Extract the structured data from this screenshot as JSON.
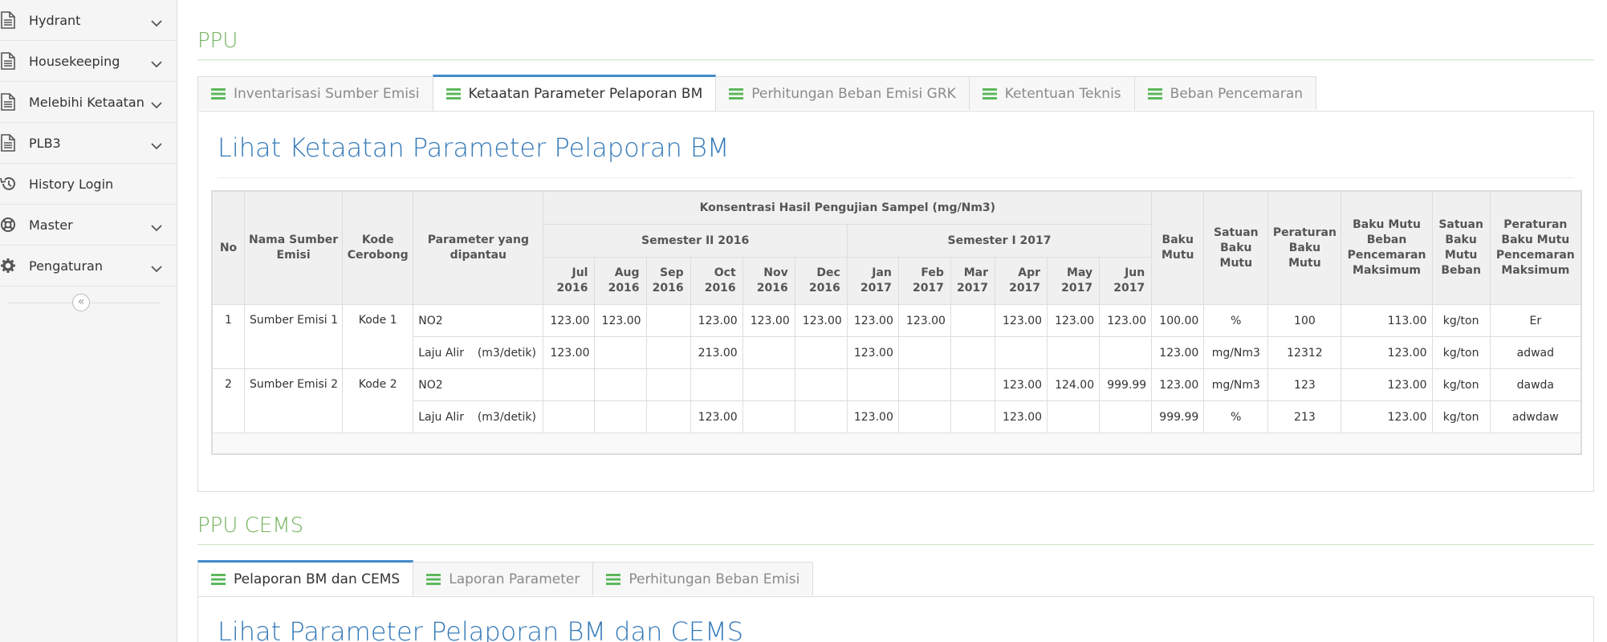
{
  "sidebar": {
    "items": [
      {
        "label": "Hydrant",
        "icon": "file-icon",
        "has_children": true
      },
      {
        "label": "Housekeeping",
        "icon": "file-icon",
        "has_children": true
      },
      {
        "label": "Melebihi Ketaatan",
        "icon": "file-icon",
        "has_children": true
      },
      {
        "label": "PLB3",
        "icon": "file-icon",
        "has_children": true
      },
      {
        "label": "History Login",
        "icon": "history-icon",
        "has_children": false
      },
      {
        "label": "Master",
        "icon": "lifebuoy-icon",
        "has_children": true
      },
      {
        "label": "Pengaturan",
        "icon": "gear-icon",
        "has_children": true
      }
    ],
    "collapse_glyph": "«"
  },
  "ppu": {
    "title": "PPU",
    "tabs": [
      {
        "label": "Inventarisasi Sumber Emisi",
        "active": false
      },
      {
        "label": "Ketaatan Parameter Pelaporan BM",
        "active": true
      },
      {
        "label": "Perhitungan Beban Emisi GRK",
        "active": false
      },
      {
        "label": "Ketentuan Teknis",
        "active": false
      },
      {
        "label": "Beban Pencemaran",
        "active": false
      }
    ],
    "panel_title": "Lihat Ketaatan Parameter Pelaporan BM",
    "table": {
      "h_no": "No",
      "h_nama": "Nama Sumber Emisi",
      "h_kode": "Kode Cerobong",
      "h_param": "Parameter yang dipantau",
      "h_konsentrasi": "Konsentrasi Hasil Pengujian Sampel (mg/Nm3)",
      "h_sem1": "Semester II 2016",
      "h_sem2": "Semester I 2017",
      "months": [
        {
          "m": "Jul",
          "y": "2016"
        },
        {
          "m": "Aug",
          "y": "2016"
        },
        {
          "m": "Sep",
          "y": "2016"
        },
        {
          "m": "Oct",
          "y": "2016"
        },
        {
          "m": "Nov",
          "y": "2016"
        },
        {
          "m": "Dec",
          "y": "2016"
        },
        {
          "m": "Jan",
          "y": "2017"
        },
        {
          "m": "Feb",
          "y": "2017"
        },
        {
          "m": "Mar",
          "y": "2017"
        },
        {
          "m": "Apr",
          "y": "2017"
        },
        {
          "m": "May",
          "y": "2017"
        },
        {
          "m": "Jun",
          "y": "2017"
        }
      ],
      "h_baku": "Baku Mutu",
      "h_satuan": "Satuan Baku Mutu",
      "h_peraturan": "Peraturan Baku Mutu",
      "h_bm_beban": "Baku Mutu Beban Pencemaran Maksimum",
      "h_satuan_beban": "Satuan Baku Mutu Beban",
      "h_peraturan_beban": "Peraturan Baku Mutu Pencemaran Maksimum",
      "rows": [
        {
          "no": "1",
          "nama": "Sumber Emisi 1",
          "kode": "Kode 1",
          "param": "NO2",
          "vals": [
            "123.00",
            "123.00",
            "",
            "123.00",
            "123.00",
            "123.00",
            "123.00",
            "123.00",
            "",
            "123.00",
            "123.00",
            "123.00"
          ],
          "baku": "100.00",
          "satuan": "%",
          "peraturan": "100",
          "bm_beban": "113.00",
          "satuan_beban": "kg/ton",
          "peraturan_beban": "Er",
          "laju_label": "Laju Alir",
          "laju_unit": "(m3/detik)",
          "laju_vals": [
            "123.00",
            "",
            "",
            "213.00",
            "",
            "",
            "123.00",
            "",
            "",
            "",
            "",
            ""
          ],
          "laju_baku": "123.00",
          "laju_satuan": "mg/Nm3",
          "laju_peraturan": "12312",
          "laju_bm_beban": "123.00",
          "laju_satuan_beban": "kg/ton",
          "laju_peraturan_beban": "adwad"
        },
        {
          "no": "2",
          "nama": "Sumber Emisi 2",
          "kode": "Kode 2",
          "param": "NO2",
          "vals": [
            "",
            "",
            "",
            "",
            "",
            "",
            "",
            "",
            "",
            "123.00",
            "124.00",
            "999.99"
          ],
          "baku": "123.00",
          "satuan": "mg/Nm3",
          "peraturan": "123",
          "bm_beban": "123.00",
          "satuan_beban": "kg/ton",
          "peraturan_beban": "dawda",
          "laju_label": "Laju Alir",
          "laju_unit": "(m3/detik)",
          "laju_vals": [
            "",
            "",
            "",
            "123.00",
            "",
            "",
            "123.00",
            "",
            "",
            "123.00",
            "",
            ""
          ],
          "laju_baku": "999.99",
          "laju_satuan": "%",
          "laju_peraturan": "213",
          "laju_bm_beban": "123.00",
          "laju_satuan_beban": "kg/ton",
          "laju_peraturan_beban": "adwdaw"
        }
      ]
    }
  },
  "ppu_cems": {
    "title": "PPU CEMS",
    "tabs": [
      {
        "label": "Pelaporan BM dan CEMS",
        "active": true
      },
      {
        "label": "Laporan Parameter",
        "active": false
      },
      {
        "label": "Perhitungan Beban Emisi",
        "active": false
      }
    ],
    "panel_title": "Lihat Parameter Pelaporan BM dan CEMS"
  },
  "colors": {
    "section_green": "#72b35b",
    "tab_icon_green": "#5cb85c",
    "title_blue": "#3479b7",
    "active_tab_border": "#428bca"
  }
}
